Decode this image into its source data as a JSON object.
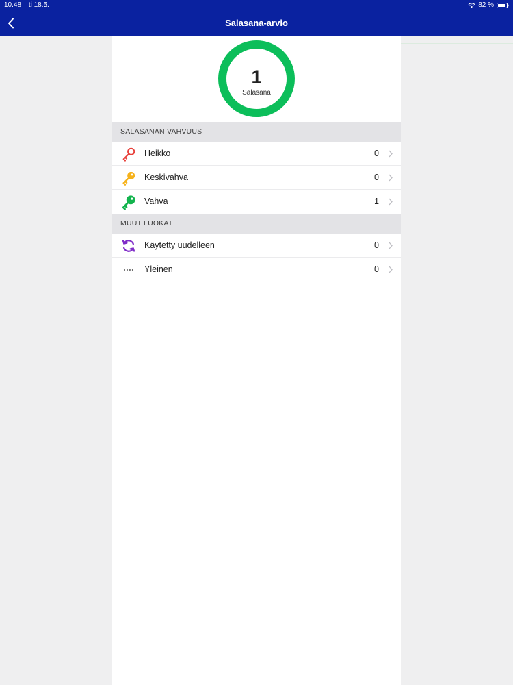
{
  "status_bar": {
    "time": "10.48",
    "date": "ti 18.5.",
    "battery": "82 %"
  },
  "nav": {
    "title": "Salasana-arvio"
  },
  "summary": {
    "count": "1",
    "label": "Salasana",
    "ring_color": "#0cbe5a"
  },
  "sections": [
    {
      "title": "SALASANAN VAHVUUS",
      "items": [
        {
          "icon": "red-key-icon",
          "color": "#e8413b",
          "label": "Heikko",
          "count": "0"
        },
        {
          "icon": "yellow-key-icon",
          "color": "#f6b21b",
          "label": "Keskivahva",
          "count": "0"
        },
        {
          "icon": "green-key-icon",
          "color": "#13b44e",
          "label": "Vahva",
          "count": "1"
        }
      ]
    },
    {
      "title": "MUUT LUOKAT",
      "items": [
        {
          "icon": "refresh-icon",
          "color": "#7f2cc8",
          "label": "Käytetty uudelleen",
          "count": "0"
        },
        {
          "icon": "asterisks-icon",
          "color": "#555555",
          "label": "Yleinen",
          "count": "0"
        }
      ]
    }
  ],
  "colors": {
    "header_bg": "#0a22a0",
    "section_bg": "#e3e3e6",
    "chevron": "#bdbdc2"
  }
}
